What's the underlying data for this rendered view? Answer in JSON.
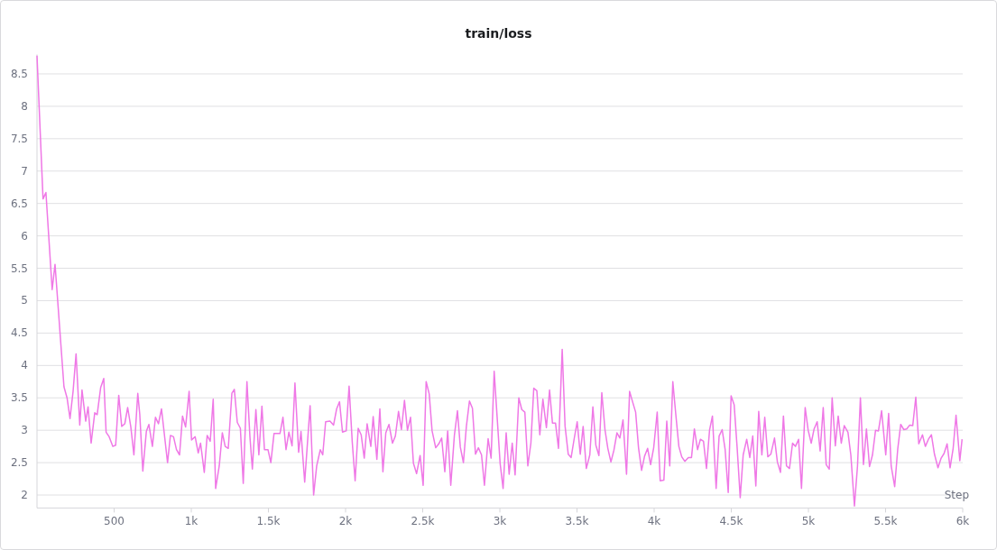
{
  "panel": {
    "chart_data": {
      "type": "line",
      "title": "train/loss",
      "xlabel": "Step",
      "grid": true,
      "xlim": [
        0,
        6000
      ],
      "ylim": [
        1.8,
        8.8
      ],
      "xticks": [
        {
          "value": 500,
          "label": "500"
        },
        {
          "value": 1000,
          "label": "1k"
        },
        {
          "value": 1500,
          "label": "1.5k"
        },
        {
          "value": 2000,
          "label": "2k"
        },
        {
          "value": 2500,
          "label": "2.5k"
        },
        {
          "value": 3000,
          "label": "3k"
        },
        {
          "value": 3500,
          "label": "3.5k"
        },
        {
          "value": 4000,
          "label": "4k"
        },
        {
          "value": 4500,
          "label": "4.5k"
        },
        {
          "value": 5000,
          "label": "5k"
        },
        {
          "value": 5500,
          "label": "5.5k"
        },
        {
          "value": 6000,
          "label": "6k"
        }
      ],
      "yticks": [
        2,
        2.5,
        3,
        3.5,
        4,
        4.5,
        5,
        5.5,
        6,
        6.5,
        7,
        7.5,
        8,
        8.5
      ],
      "x": [
        0,
        39,
        58,
        98,
        117,
        175,
        195,
        214,
        234,
        253,
        277,
        292,
        316,
        331,
        351,
        374,
        390,
        413,
        433,
        448,
        468,
        491,
        510,
        530,
        549,
        569,
        588,
        608,
        628,
        653,
        666,
        686,
        709,
        725,
        748,
        768,
        787,
        807,
        846,
        865,
        885,
        904,
        924,
        943,
        963,
        986,
        1002,
        1025,
        1045,
        1060,
        1084,
        1103,
        1123,
        1142,
        1158,
        1181,
        1201,
        1220,
        1240,
        1263,
        1279,
        1298,
        1318,
        1337,
        1361,
        1380,
        1396,
        1419,
        1438,
        1458,
        1474,
        1497,
        1516,
        1536,
        1575,
        1594,
        1614,
        1633,
        1653,
        1672,
        1696,
        1711,
        1735,
        1770,
        1793,
        1813,
        1836,
        1852,
        1871,
        1899,
        1922,
        1942,
        1961,
        1980,
        2004,
        2023,
        2043,
        2062,
        2082,
        2101,
        2121,
        2140,
        2164,
        2179,
        2203,
        2222,
        2242,
        2261,
        2281,
        2304,
        2323,
        2343,
        2362,
        2382,
        2401,
        2421,
        2440,
        2460,
        2483,
        2503,
        2522,
        2542,
        2561,
        2584,
        2604,
        2623,
        2643,
        2662,
        2682,
        2705,
        2725,
        2744,
        2764,
        2783,
        2803,
        2822,
        2842,
        2861,
        2881,
        2900,
        2924,
        2943,
        2963,
        2982,
        3002,
        3021,
        3041,
        3060,
        3080,
        3099,
        3123,
        3142,
        3162,
        3181,
        3201,
        3220,
        3240,
        3259,
        3279,
        3302,
        3322,
        3341,
        3361,
        3380,
        3404,
        3423,
        3443,
        3462,
        3482,
        3501,
        3521,
        3540,
        3560,
        3583,
        3603,
        3622,
        3642,
        3661,
        3681,
        3700,
        3720,
        3739,
        3759,
        3778,
        3798,
        3821,
        3841,
        3860,
        3880,
        3899,
        3919,
        3938,
        3958,
        3977,
        3997,
        4020,
        4039,
        4063,
        4082,
        4101,
        4121,
        4140,
        4160,
        4179,
        4199,
        4222,
        4242,
        4261,
        4281,
        4300,
        4320,
        4339,
        4359,
        4378,
        4402,
        4421,
        4441,
        4460,
        4480,
        4499,
        4519,
        4538,
        4558,
        4577,
        4600,
        4620,
        4639,
        4659,
        4678,
        4698,
        4717,
        4737,
        4756,
        4780,
        4799,
        4819,
        4838,
        4858,
        4877,
        4897,
        4916,
        4936,
        4955,
        4979,
        4998,
        5018,
        5037,
        5057,
        5076,
        5096,
        5115,
        5135,
        5154,
        5174,
        5193,
        5213,
        5232,
        5256,
        5275,
        5298,
        5318,
        5337,
        5357,
        5376,
        5396,
        5415,
        5435,
        5454,
        5474,
        5501,
        5520,
        5536,
        5559,
        5579,
        5598,
        5618,
        5637,
        5657,
        5676,
        5696,
        5715,
        5739,
        5758,
        5778,
        5797,
        5817,
        5840,
        5860,
        5879,
        5899,
        5918,
        5938,
        5957,
        5981,
        5996
      ],
      "series": [
        {
          "color": "#ef78e6",
          "values": [
            8.78,
            6.57,
            6.67,
            5.17,
            5.56,
            3.67,
            3.5,
            3.18,
            3.6,
            4.18,
            3.08,
            3.62,
            3.14,
            3.36,
            2.8,
            3.27,
            3.24,
            3.66,
            3.8,
            2.97,
            2.9,
            2.75,
            2.77,
            3.54,
            3.06,
            3.1,
            3.35,
            3.05,
            2.62,
            3.57,
            3.25,
            2.37,
            2.98,
            3.09,
            2.75,
            3.2,
            3.1,
            3.33,
            2.5,
            2.92,
            2.9,
            2.7,
            2.62,
            3.22,
            3.05,
            3.6,
            2.85,
            2.9,
            2.65,
            2.8,
            2.35,
            2.92,
            2.83,
            3.48,
            2.1,
            2.45,
            2.96,
            2.75,
            2.72,
            3.57,
            3.63,
            3.12,
            3.03,
            2.18,
            3.75,
            2.9,
            2.4,
            3.32,
            2.62,
            3.37,
            2.7,
            2.7,
            2.5,
            2.95,
            2.95,
            3.2,
            2.7,
            2.97,
            2.76,
            3.73,
            2.66,
            2.98,
            2.2,
            3.38,
            2.0,
            2.45,
            2.7,
            2.62,
            3.13,
            3.14,
            3.08,
            3.33,
            3.44,
            2.97,
            2.99,
            3.68,
            2.82,
            2.22,
            3.03,
            2.93,
            2.57,
            3.1,
            2.75,
            3.21,
            2.55,
            3.33,
            2.36,
            2.96,
            3.09,
            2.8,
            2.91,
            3.29,
            3.01,
            3.46,
            3.0,
            3.2,
            2.49,
            2.33,
            2.61,
            2.15,
            3.75,
            3.56,
            2.99,
            2.73,
            2.79,
            2.88,
            2.36,
            2.99,
            2.15,
            2.92,
            3.3,
            2.74,
            2.5,
            3.06,
            3.45,
            3.34,
            2.63,
            2.73,
            2.62,
            2.15,
            2.87,
            2.57,
            3.91,
            3.22,
            2.49,
            2.1,
            2.96,
            2.32,
            2.8,
            2.31,
            3.5,
            3.32,
            3.28,
            2.45,
            2.8,
            3.65,
            3.61,
            2.93,
            3.48,
            3.04,
            3.62,
            3.11,
            3.11,
            2.72,
            4.25,
            3.06,
            2.63,
            2.58,
            2.87,
            3.13,
            2.63,
            3.06,
            2.41,
            2.62,
            3.36,
            2.77,
            2.61,
            3.58,
            3.01,
            2.72,
            2.51,
            2.69,
            2.96,
            2.88,
            3.16,
            2.32,
            3.6,
            3.44,
            3.28,
            2.73,
            2.38,
            2.6,
            2.72,
            2.47,
            2.73,
            3.28,
            2.22,
            2.23,
            3.14,
            2.45,
            3.75,
            3.26,
            2.75,
            2.59,
            2.52,
            2.58,
            2.58,
            3.02,
            2.7,
            2.86,
            2.83,
            2.41,
            3.0,
            3.22,
            2.1,
            2.91,
            3.01,
            2.7,
            2.04,
            3.53,
            3.39,
            2.73,
            1.96,
            2.62,
            2.86,
            2.58,
            2.91,
            2.14,
            3.29,
            2.62,
            3.2,
            2.59,
            2.63,
            2.88,
            2.51,
            2.35,
            3.22,
            2.45,
            2.41,
            2.8,
            2.75,
            2.86,
            2.1,
            3.35,
            3.0,
            2.8,
            3.02,
            3.13,
            2.68,
            3.35,
            2.47,
            2.4,
            3.5,
            2.76,
            3.22,
            2.8,
            3.07,
            2.97,
            2.62,
            1.83,
            2.45,
            3.5,
            2.47,
            3.02,
            2.44,
            2.62,
            3.0,
            2.99,
            3.3,
            2.62,
            3.26,
            2.45,
            2.13,
            2.71,
            3.09,
            3.01,
            3.02,
            3.08,
            3.07,
            3.51,
            2.79,
            2.93,
            2.75,
            2.86,
            2.93,
            2.63,
            2.42,
            2.57,
            2.64,
            2.79,
            2.42,
            2.72,
            3.23,
            2.53,
            2.86
          ]
        }
      ]
    }
  }
}
